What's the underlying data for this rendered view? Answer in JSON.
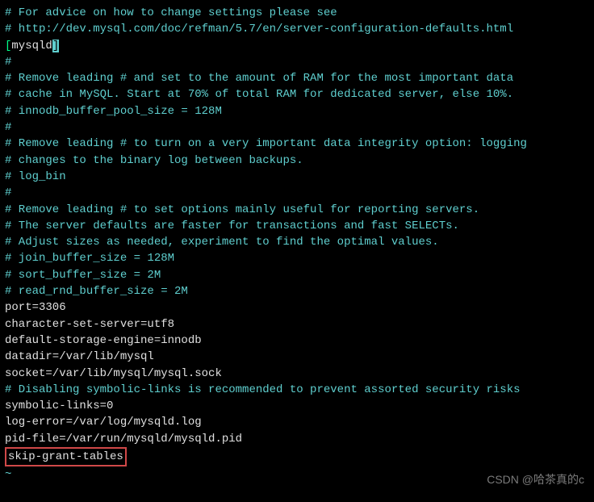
{
  "c01": "# For advice on how to change settings please see",
  "c02": "# http://dev.mysql.com/doc/refman/5.7/en/server-configuration-defaults.html",
  "blank1": "",
  "bracket_open": "[",
  "section": "mysqld",
  "bracket_close": "]",
  "c03": "#",
  "c04": "# Remove leading # and set to the amount of RAM for the most important data",
  "c05": "# cache in MySQL. Start at 70% of total RAM for dedicated server, else 10%.",
  "c06": "# innodb_buffer_pool_size = 128M",
  "c07": "#",
  "c08": "# Remove leading # to turn on a very important data integrity option: logging",
  "c09": "# changes to the binary log between backups.",
  "c10": "# log_bin",
  "c11": "#",
  "c12": "# Remove leading # to set options mainly useful for reporting servers.",
  "c13": "# The server defaults are faster for transactions and fast SELECTs.",
  "c14": "# Adjust sizes as needed, experiment to find the optimal values.",
  "c15": "# join_buffer_size = 128M",
  "c16": "# sort_buffer_size = 2M",
  "c17": "# read_rnd_buffer_size = 2M",
  "p01": "port=3306",
  "p02": "character-set-server=utf8",
  "p03": "default-storage-engine=innodb",
  "blank2": "",
  "p04": "datadir=/var/lib/mysql",
  "p05": "socket=/var/lib/mysql/mysql.sock",
  "blank3": "",
  "c18": "# Disabling symbolic-links is recommended to prevent assorted security risks",
  "p06": "symbolic-links=0",
  "blank4": "",
  "p07": "log-error=/var/log/mysqld.log",
  "p08": "pid-file=/var/run/mysqld/mysqld.pid",
  "p09": "skip-grant-tables",
  "tilde": "~",
  "watermark": "CSDN @哈茶真的c"
}
